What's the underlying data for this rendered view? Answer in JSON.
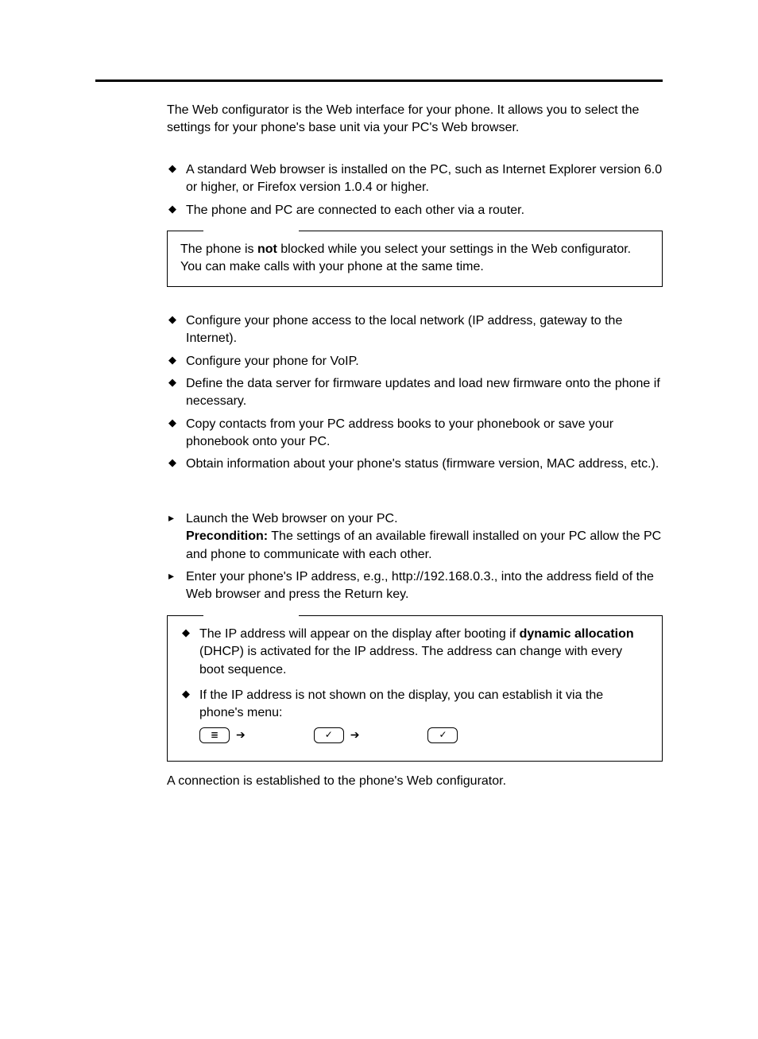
{
  "intro": "The Web configurator is the Web interface for your phone. It allows you to select the settings for your phone's base unit via your PC's Web browser.",
  "prereqs": [
    "A standard Web browser is installed on the PC, such as Internet Explorer version 6.0 or higher, or Firefox version 1.0.4 or higher.",
    "The phone and PC are connected to each other via a router."
  ],
  "note1": {
    "pre": "The phone is ",
    "bold": "not",
    "post": " blocked while you select your settings in the Web configurator. You can make calls with your phone at the same time."
  },
  "capabilities": [
    "Configure your phone access to the local network (IP address, gateway to the Internet).",
    "Configure your phone for VoIP.",
    "Define the data server for firmware updates and load new firmware onto the phone if necessary.",
    "Copy contacts from your PC address books to your phonebook or save your phonebook onto your PC.",
    "Obtain information about your phone's status (firmware version, MAC address, etc.)."
  ],
  "steps": {
    "s1": "Launch the Web browser on your PC.",
    "preLabel": "Precondition:",
    "preText": " The settings of an available firewall installed on your PC allow the PC and phone to communicate with each other.",
    "s2": "Enter your phone's IP address, e.g., http://192.168.0.3., into the address field of the Web browser and press the Return key."
  },
  "note2": {
    "b1pre": "The IP address will appear on the display after booting if ",
    "b1bold": "dynamic allocation",
    "b1post": " (DHCP) is activated for the IP address. The address can change with every boot sequence.",
    "b2": "If the IP address is not shown on the display, you can establish it via the phone's menu:"
  },
  "icons": {
    "menu": "≣",
    "check": "✓",
    "arrow": "➔"
  },
  "closing": "A connection is established to the phone's Web configurator."
}
